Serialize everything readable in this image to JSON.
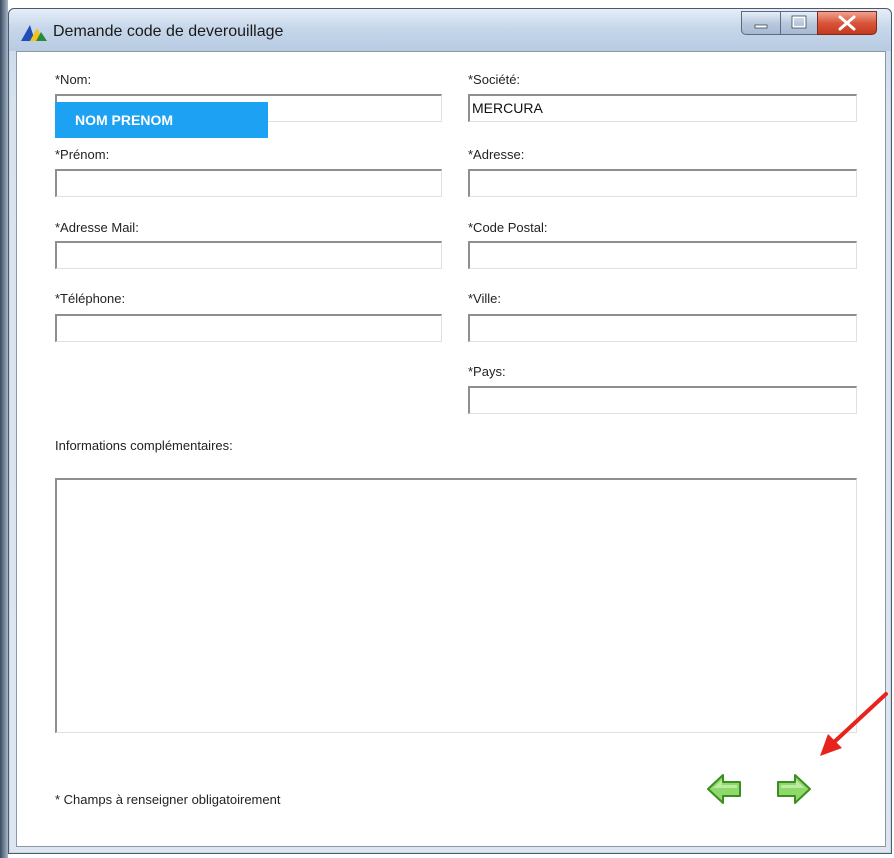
{
  "window": {
    "title": "Demande code de deverouillage"
  },
  "form": {
    "nom": {
      "label": "*Nom:",
      "value": "",
      "overlay_text": "NOM PRENOM"
    },
    "societe": {
      "label": "*Société:",
      "value": "MERCURA"
    },
    "prenom": {
      "label": "*Prénom:",
      "value": ""
    },
    "adresse": {
      "label": "*Adresse:",
      "value": ""
    },
    "mail": {
      "label": "*Adresse Mail:",
      "value": ""
    },
    "code_postal": {
      "label": "*Code Postal:",
      "value": ""
    },
    "telephone": {
      "label": "*Téléphone:",
      "value": ""
    },
    "ville": {
      "label": "*Ville:",
      "value": ""
    },
    "pays": {
      "label": "*Pays:",
      "value": ""
    },
    "infos": {
      "label": "Informations complémentaires:",
      "value": ""
    }
  },
  "footer": {
    "note": "* Champs à renseigner obligatoirement"
  },
  "icons": {
    "back": "arrow-left-green",
    "next": "arrow-right-green",
    "annotation": "red-pointer-arrow"
  },
  "colors": {
    "highlight": "#1da1f2",
    "arrow_green": "#5fbf3a",
    "annotation_red": "#e8231c"
  }
}
